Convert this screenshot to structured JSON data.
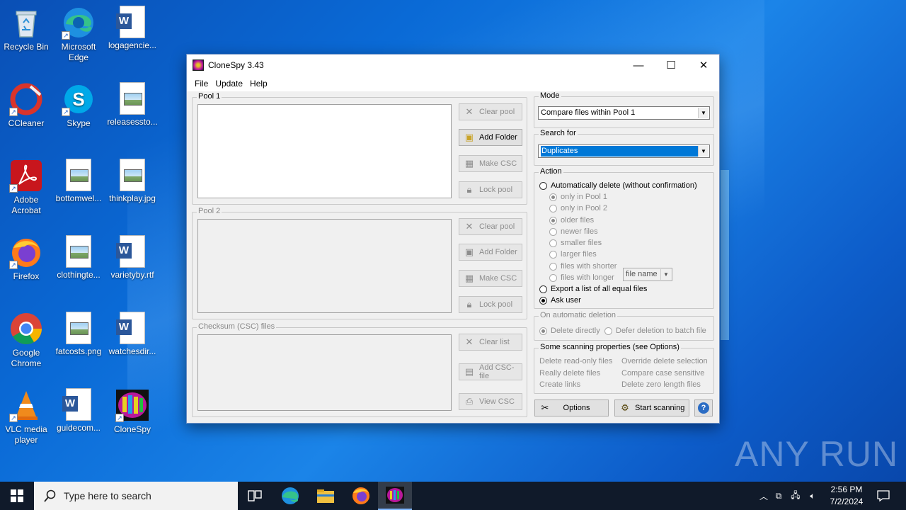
{
  "desktop": {
    "icons": [
      {
        "label": "Recycle Bin",
        "icon": "recycle-bin-icon"
      },
      {
        "label": "Microsoft Edge",
        "icon": "edge-icon"
      },
      {
        "label": "logagencie...",
        "icon": "word-doc-icon"
      },
      {
        "label": "CCleaner",
        "icon": "ccleaner-icon"
      },
      {
        "label": "Skype",
        "icon": "skype-icon"
      },
      {
        "label": "releasessto...",
        "icon": "image-file-icon"
      },
      {
        "label": "Adobe Acrobat",
        "icon": "acrobat-icon"
      },
      {
        "label": "bottomwel...",
        "icon": "image-file-icon"
      },
      {
        "label": "thinkplay.jpg",
        "icon": "image-file-icon"
      },
      {
        "label": "Firefox",
        "icon": "firefox-icon"
      },
      {
        "label": "clothingte...",
        "icon": "image-file-icon"
      },
      {
        "label": "varietyby.rtf",
        "icon": "word-doc-icon"
      },
      {
        "label": "Google Chrome",
        "icon": "chrome-icon"
      },
      {
        "label": "fatcosts.png",
        "icon": "image-file-icon"
      },
      {
        "label": "watchesdir...",
        "icon": "word-doc-icon"
      },
      {
        "label": "VLC media player",
        "icon": "vlc-icon"
      },
      {
        "label": "guidecom...",
        "icon": "word-doc-icon"
      },
      {
        "label": "CloneSpy",
        "icon": "clonespy-icon"
      }
    ],
    "watermark": "ANY RUN"
  },
  "window": {
    "title": "CloneSpy 3.43",
    "menu": [
      "File",
      "Update",
      "Help"
    ],
    "pool1": {
      "label": "Pool 1",
      "buttons": {
        "clear": "Clear pool",
        "add": "Add Folder",
        "csc": "Make CSC",
        "lock": "Lock pool"
      }
    },
    "pool2": {
      "label": "Pool 2",
      "buttons": {
        "clear": "Clear pool",
        "add": "Add Folder",
        "csc": "Make CSC",
        "lock": "Lock pool"
      }
    },
    "checksum": {
      "label": "Checksum (CSC) files",
      "buttons": {
        "clear": "Clear list",
        "add": "Add CSC-file",
        "view": "View CSC"
      }
    },
    "mode": {
      "label": "Mode",
      "value": "Compare files within Pool 1"
    },
    "search_for": {
      "label": "Search for",
      "value": "Duplicates"
    },
    "action": {
      "label": "Action",
      "auto_delete": "Automatically delete (without confirmation)",
      "sub_options": [
        "only in Pool 1",
        "only in Pool 2",
        "older files",
        "newer files",
        "smaller files",
        "larger files",
        "files with shorter",
        "files with longer"
      ],
      "name_select": "file name",
      "export": "Export a list of all equal files",
      "ask_user": "Ask user"
    },
    "on_auto_delete": {
      "label": "On automatic deletion",
      "delete_directly": "Delete directly",
      "defer": "Defer deletion to batch file"
    },
    "scan_props": {
      "label": "Some scanning properties (see Options)",
      "items": [
        "Delete read-only files",
        "Override delete selection",
        "Really delete files",
        "Compare case sensitive",
        "Create links",
        "Delete zero length files"
      ]
    },
    "buttons": {
      "options": "Options",
      "start": "Start scanning",
      "help": "?"
    }
  },
  "taskbar": {
    "search_placeholder": "Type here to search",
    "time": "2:56 PM",
    "date": "7/2/2024"
  }
}
